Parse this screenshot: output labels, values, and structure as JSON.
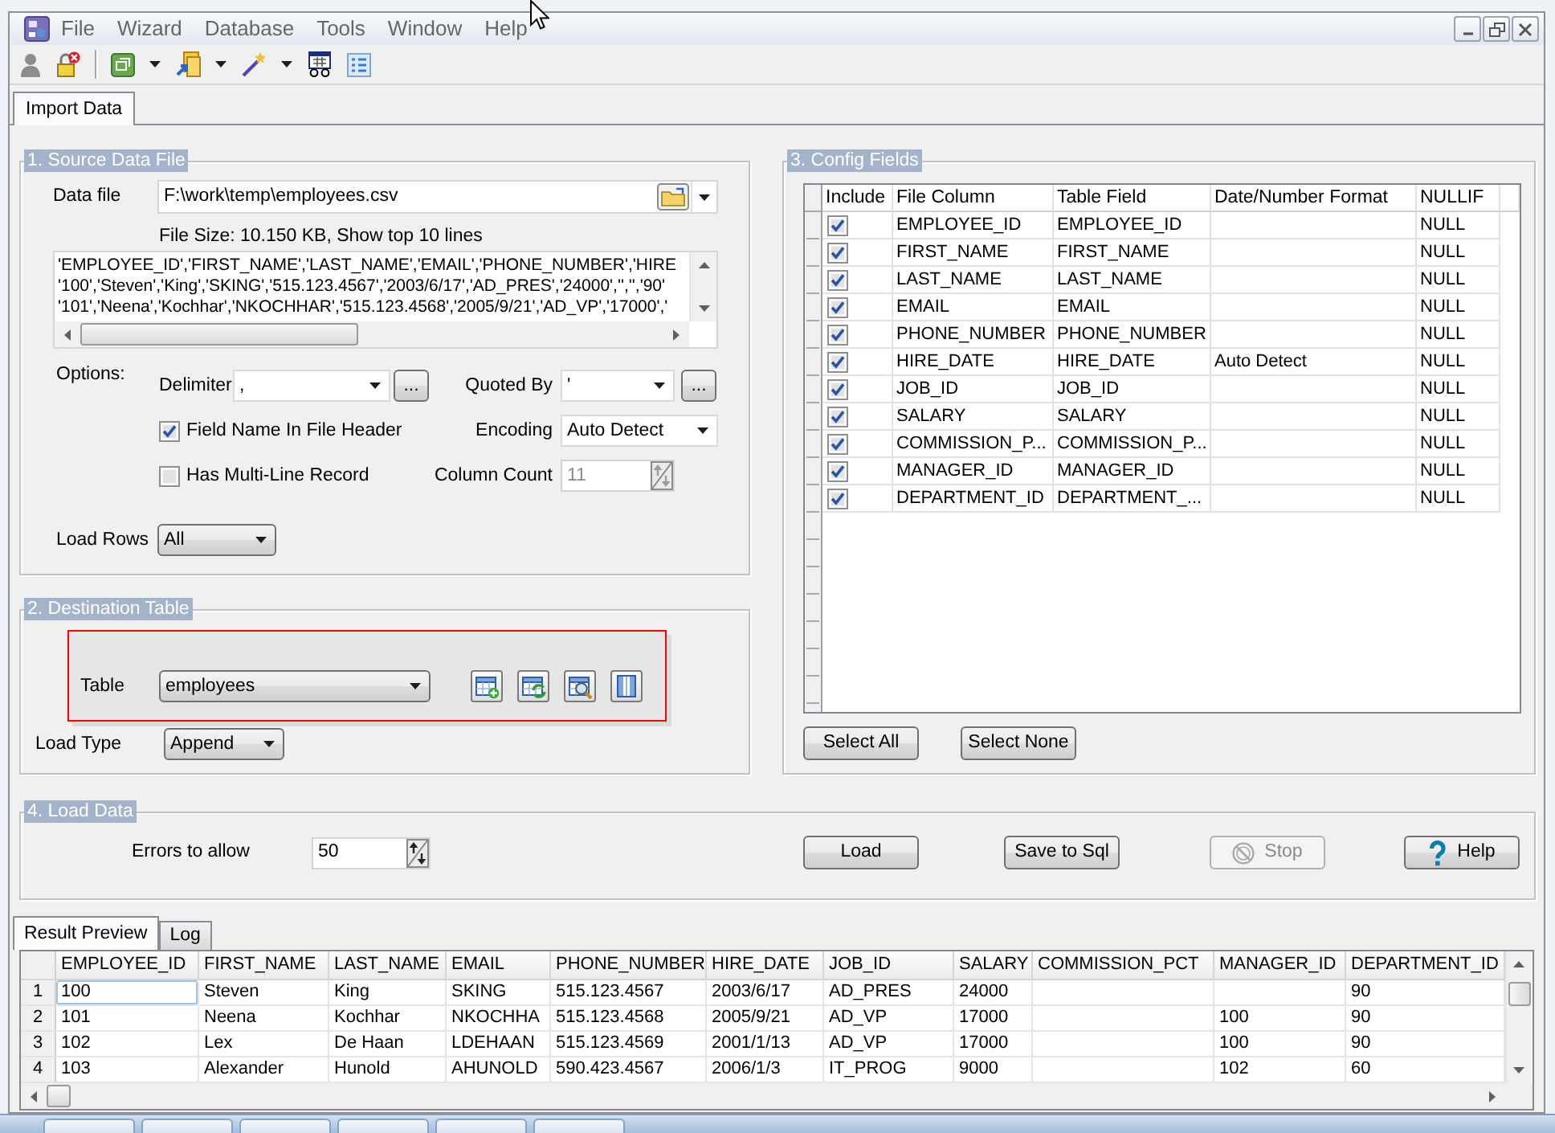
{
  "menu": [
    "File",
    "Wizard",
    "Database",
    "Tools",
    "Window",
    "Help"
  ],
  "tabs": [
    {
      "label": "Import Data",
      "selected": true
    }
  ],
  "source": {
    "title": "1. Source Data File",
    "data_file": {
      "label": "Data file",
      "value": "F:\\work\\temp\\employees.csv"
    },
    "file_info": "File Size: 10.150 KB, Show top 10 lines",
    "preview_lines": [
      "'EMPLOYEE_ID','FIRST_NAME','LAST_NAME','EMAIL','PHONE_NUMBER','HIRE",
      "'100','Steven','King','SKING','515.123.4567','2003/6/17','AD_PRES','24000','','','90'",
      "'101','Neena','Kochhar','NKOCHHAR','515.123.4568','2005/9/21','AD_VP','17000','"
    ],
    "options_label": "Options:",
    "delimiter": {
      "label": "Delimiter",
      "value": ",",
      "button": "..."
    },
    "quoted_by": {
      "label": "Quoted By",
      "value": "'",
      "button": "..."
    },
    "field_name_in_header": {
      "label": "Field Name In File Header",
      "checked": true
    },
    "multi_line_record": {
      "label": "Has Multi-Line Record",
      "checked": false
    },
    "encoding": {
      "label": "Encoding",
      "value": "Auto Detect"
    },
    "column_count": {
      "label": "Column Count",
      "value": "11",
      "disabled": true
    },
    "load_rows": {
      "label": "Load Rows",
      "value": "All"
    }
  },
  "destination": {
    "title": "2. Destination Table",
    "highlighted": true,
    "table": {
      "label": "Table",
      "value": "employees"
    },
    "load_type": {
      "label": "Load Type",
      "value": "Append"
    }
  },
  "config": {
    "title": "3. Config Fields",
    "columns": [
      "Include",
      "File Column",
      "Table Field",
      "Date/Number Format",
      "NULLIF"
    ],
    "rows": [
      {
        "include": true,
        "file_column": "EMPLOYEE_ID",
        "table_field": "EMPLOYEE_ID",
        "nullif": "NULL"
      },
      {
        "include": true,
        "file_column": "FIRST_NAME",
        "table_field": "FIRST_NAME",
        "nullif": "NULL"
      },
      {
        "include": true,
        "file_column": "LAST_NAME",
        "table_field": "LAST_NAME",
        "nullif": "NULL"
      },
      {
        "include": true,
        "file_column": "EMAIL",
        "table_field": "EMAIL",
        "nullif": "NULL"
      },
      {
        "include": true,
        "file_column": "PHONE_NUMBER",
        "table_field": "PHONE_NUMBER",
        "nullif": "NULL"
      },
      {
        "include": true,
        "file_column": "HIRE_DATE",
        "table_field": "HIRE_DATE",
        "format": "Auto Detect",
        "nullif": "NULL"
      },
      {
        "include": true,
        "file_column": "JOB_ID",
        "table_field": "JOB_ID",
        "nullif": "NULL"
      },
      {
        "include": true,
        "file_column": "SALARY",
        "table_field": "SALARY",
        "nullif": "NULL"
      },
      {
        "include": true,
        "file_column": "COMMISSION_P...",
        "table_field": "COMMISSION_P...",
        "nullif": "NULL"
      },
      {
        "include": true,
        "file_column": "MANAGER_ID",
        "table_field": "MANAGER_ID",
        "nullif": "NULL"
      },
      {
        "include": true,
        "file_column": "DEPARTMENT_ID",
        "table_field": "DEPARTMENT_...",
        "nullif": "NULL"
      }
    ],
    "buttons": [
      "Select All",
      "Select None"
    ]
  },
  "load": {
    "title": "4. Load Data",
    "errors": {
      "label": "Errors to allow",
      "value": "50"
    },
    "buttons": [
      {
        "label": "Load",
        "kind": "plain",
        "disabled": false
      },
      {
        "label": "Save to Sql",
        "kind": "plain",
        "disabled": false
      },
      {
        "label": "Stop",
        "kind": "stop",
        "disabled": true
      },
      {
        "label": "Help",
        "kind": "help",
        "disabled": false
      }
    ]
  },
  "results": {
    "tabs": [
      {
        "label": "Result Preview",
        "selected": true
      },
      {
        "label": "Log",
        "selected": false
      }
    ],
    "columns": [
      "EMPLOYEE_ID",
      "FIRST_NAME",
      "LAST_NAME",
      "EMAIL",
      "PHONE_NUMBER",
      "HIRE_DATE",
      "JOB_ID",
      "SALARY",
      "COMMISSION_PCT",
      "MANAGER_ID",
      "DEPARTMENT_ID"
    ],
    "rows": [
      {
        "number": "1",
        "selected": true,
        "cells": [
          "100",
          "Steven",
          "King",
          "SKING",
          "515.123.4567",
          "2003/6/17",
          "AD_PRES",
          "24000",
          null,
          null,
          "90"
        ]
      },
      {
        "number": "2",
        "selected": false,
        "cells": [
          "101",
          "Neena",
          "Kochhar",
          "NKOCHHA",
          "515.123.4568",
          "2005/9/21",
          "AD_VP",
          "17000",
          null,
          "100",
          "90"
        ]
      },
      {
        "number": "3",
        "selected": false,
        "cells": [
          "102",
          "Lex",
          "De Haan",
          "LDEHAAN",
          "515.123.4569",
          "2001/1/13",
          "AD_VP",
          "17000",
          null,
          "100",
          "90"
        ]
      },
      {
        "number": "4",
        "selected": false,
        "cells": [
          "103",
          "Alexander",
          "Hunold",
          "AHUNOLD",
          "590.423.4567",
          "2006/1/3",
          "IT_PROG",
          "9000",
          null,
          "102",
          "60"
        ]
      }
    ]
  }
}
